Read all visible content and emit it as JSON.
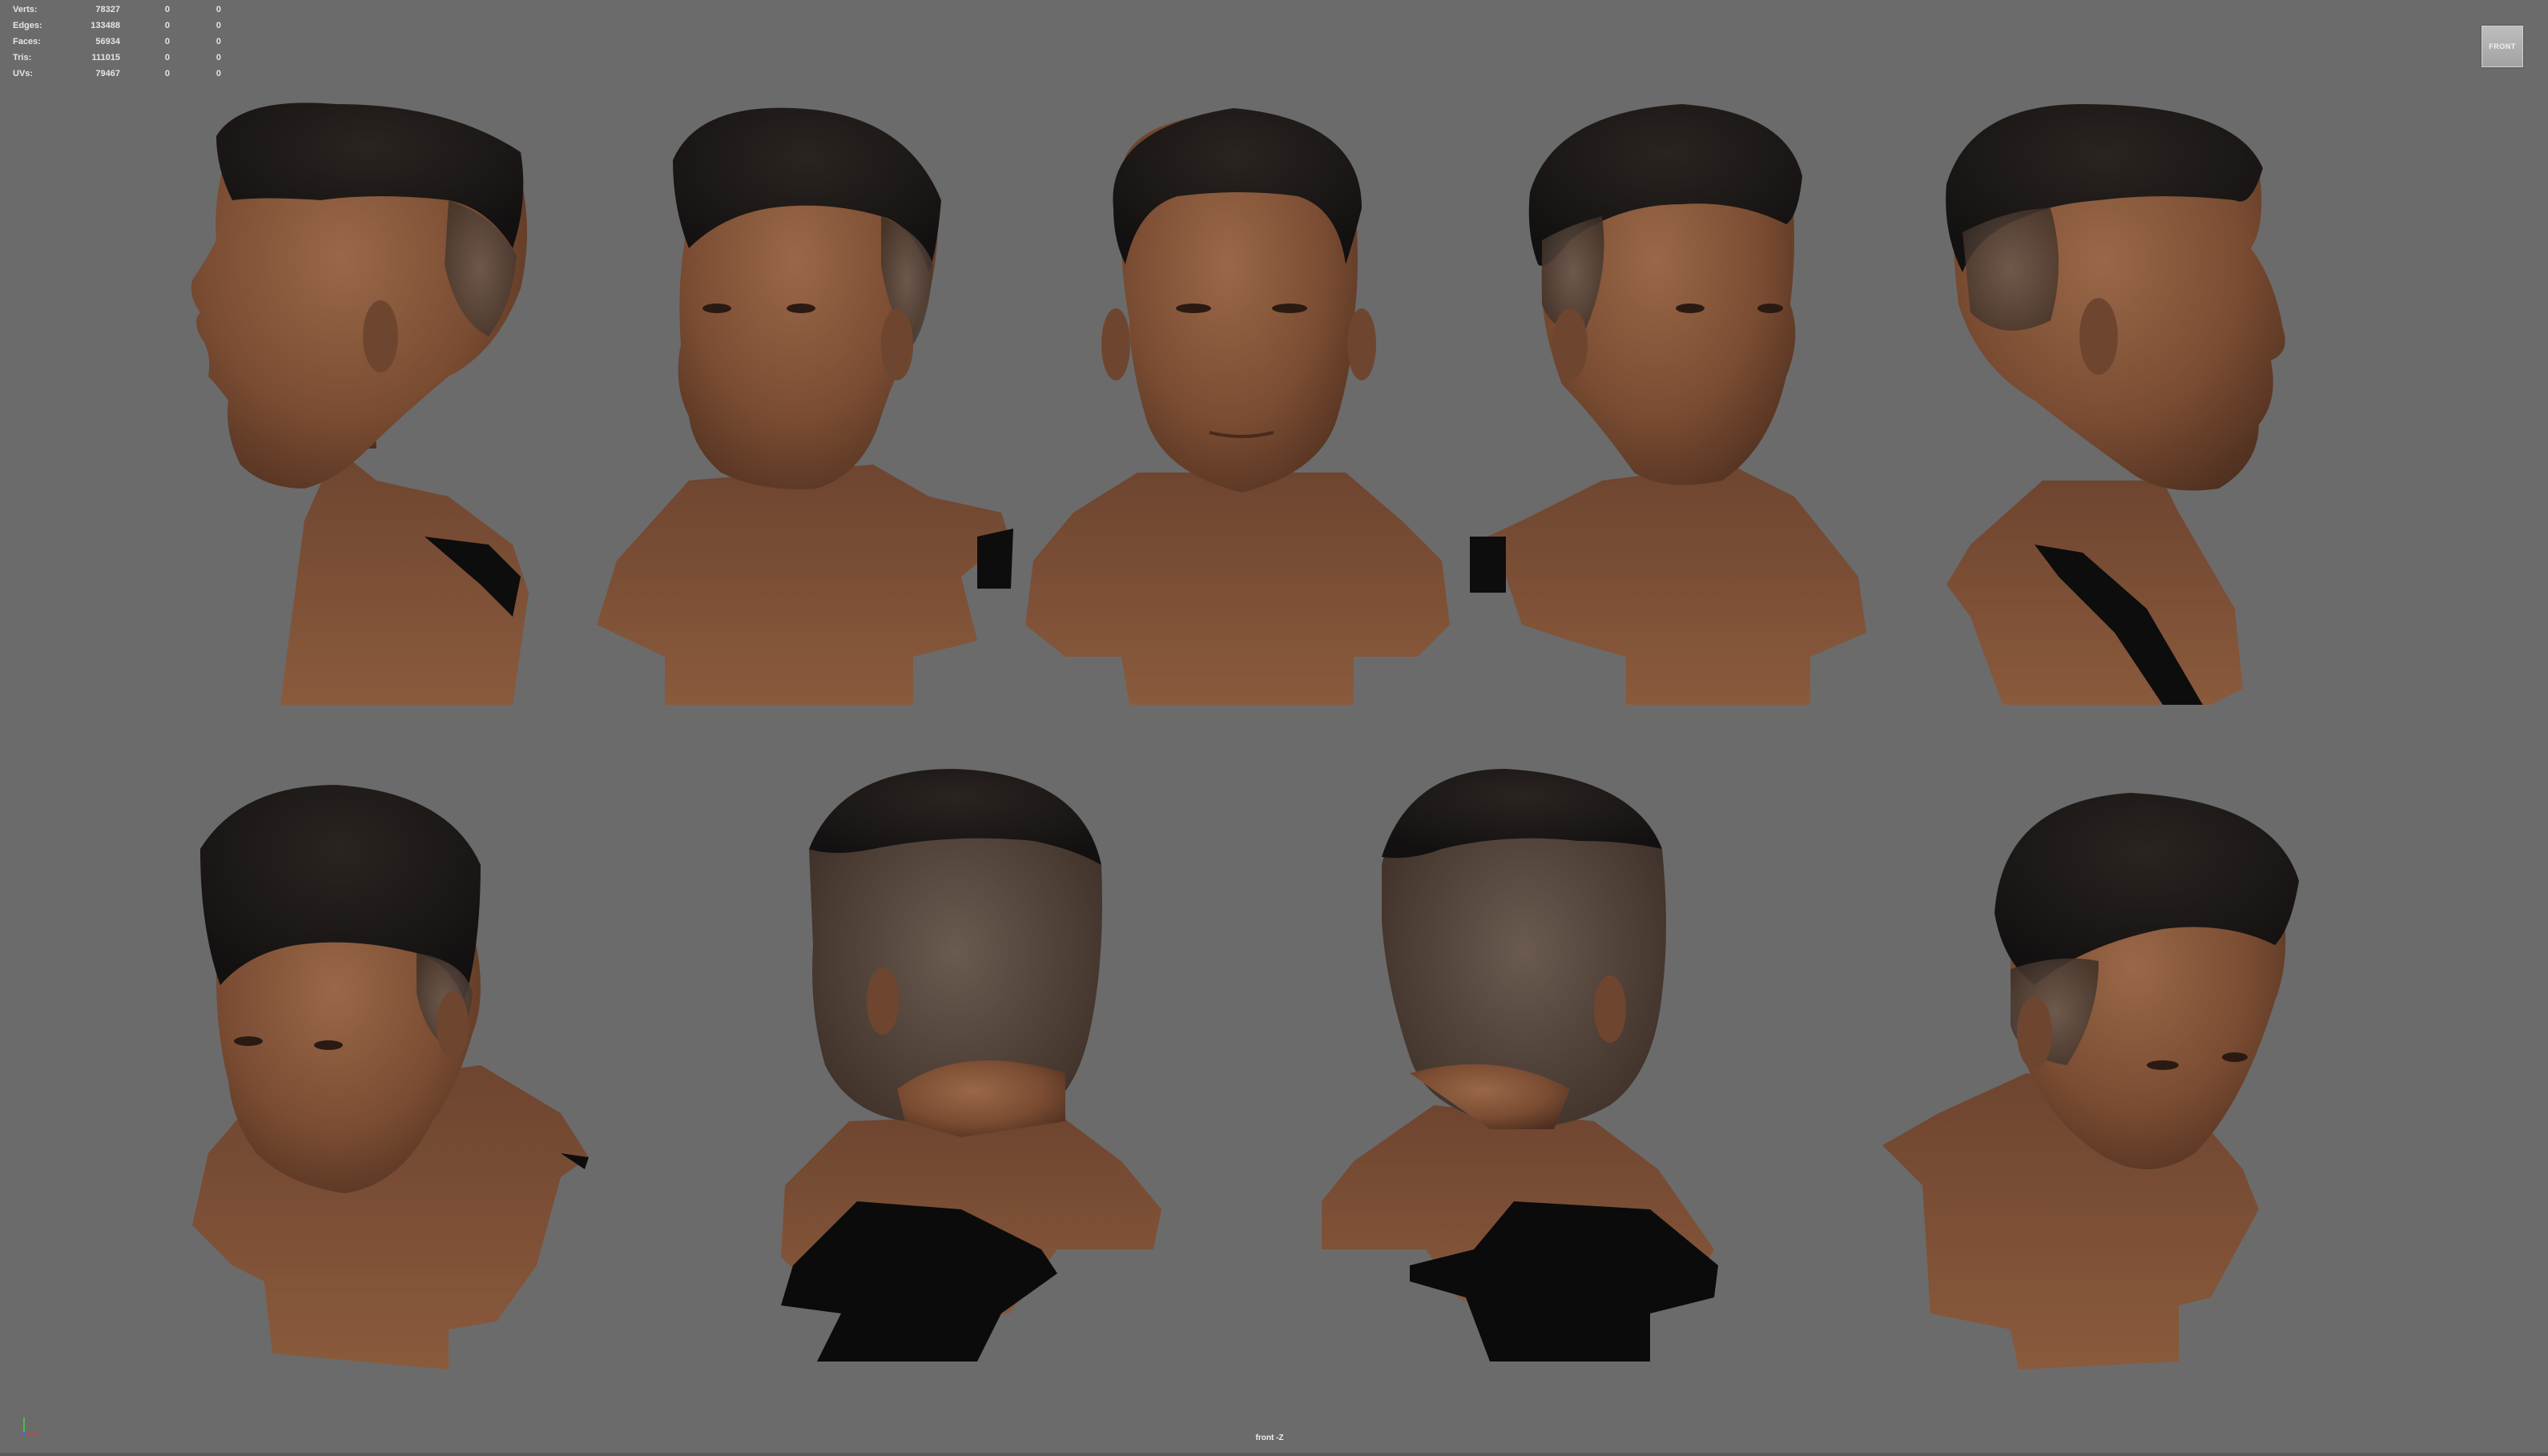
{
  "hud": {
    "rows": [
      {
        "label": "Verts:",
        "v1": "78327",
        "v2": "0",
        "v3": "0"
      },
      {
        "label": "Edges:",
        "v1": "133488",
        "v2": "0",
        "v3": "0"
      },
      {
        "label": "Faces:",
        "v1": "56934",
        "v2": "0",
        "v3": "0"
      },
      {
        "label": "Tris:",
        "v1": "111015",
        "v2": "0",
        "v3": "0"
      },
      {
        "label": "UVs:",
        "v1": "79467",
        "v2": "0",
        "v3": "0"
      }
    ]
  },
  "viewcube": {
    "label": "FRONT"
  },
  "camera": {
    "label": "front -Z"
  },
  "colors": {
    "background": "#6b6b6b",
    "skin_light": "#8a5a3c",
    "skin_dark": "#5a3826",
    "hair": "#1c1816",
    "shirt": "#0b0b0b"
  }
}
